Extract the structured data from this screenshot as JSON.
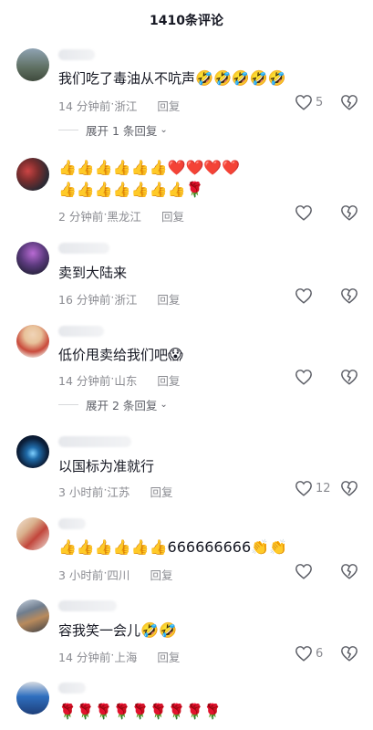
{
  "header": {
    "title": "1410条评论"
  },
  "comments": [
    {
      "text": "我们吃了毒油从不吭声",
      "emojis": "🤣🤣🤣🤣🤣",
      "time": "14 分钟前",
      "location": "浙江",
      "reply": "回复",
      "likes": "5",
      "expand": "展开 1 条回复"
    },
    {
      "row1": "👍👍👍👍👍👍❤️❤️❤️❤️",
      "row2": "👍👍👍👍👍👍👍🌹",
      "time": "2 分钟前",
      "location": "黑龙江",
      "reply": "回复",
      "likes": ""
    },
    {
      "text": "卖到大陆来",
      "time": "16 分钟前",
      "location": "浙江",
      "reply": "回复",
      "likes": ""
    },
    {
      "text": "低价甩卖给我们吧",
      "emojis": "😱",
      "time": "14 分钟前",
      "location": "山东",
      "reply": "回复",
      "likes": "",
      "expand": "展开 2 条回复"
    },
    {
      "text": "以国标为准就行",
      "time": "3 小时前",
      "location": "江苏",
      "reply": "回复",
      "likes": "12"
    },
    {
      "row1": "👍👍👍👍👍👍666666666👏👏",
      "time": "3 小时前",
      "location": "四川",
      "reply": "回复",
      "likes": ""
    },
    {
      "text": "容我笑一会儿",
      "emojis": "🤣🤣",
      "time": "14 分钟前",
      "location": "上海",
      "reply": "回复",
      "likes": "6"
    },
    {
      "row1": "🌹🌹🌹🌹🌹🌹🌹🌹🌹"
    }
  ]
}
